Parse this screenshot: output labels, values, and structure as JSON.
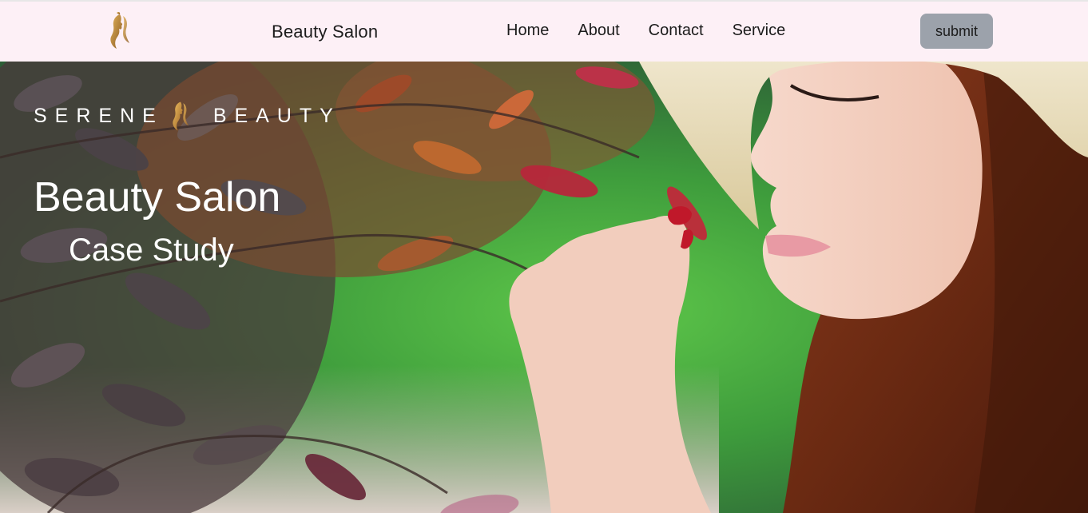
{
  "header": {
    "brand": "Beauty Salon",
    "logo_icon": "woman-silhouette-icon",
    "nav": [
      {
        "label": "Home"
      },
      {
        "label": "About"
      },
      {
        "label": "Contact"
      },
      {
        "label": "Service"
      }
    ],
    "submit_label": "submit",
    "background_color": "#fdf0f6",
    "button_color": "#9ca2ab"
  },
  "hero": {
    "tagline_left": "SERENE",
    "tagline_right": "BEAUTY",
    "tagline_icon": "woman-silhouette-icon",
    "title": "Beauty Salon",
    "subtitle": "Case Study",
    "text_color": "#ffffff"
  }
}
